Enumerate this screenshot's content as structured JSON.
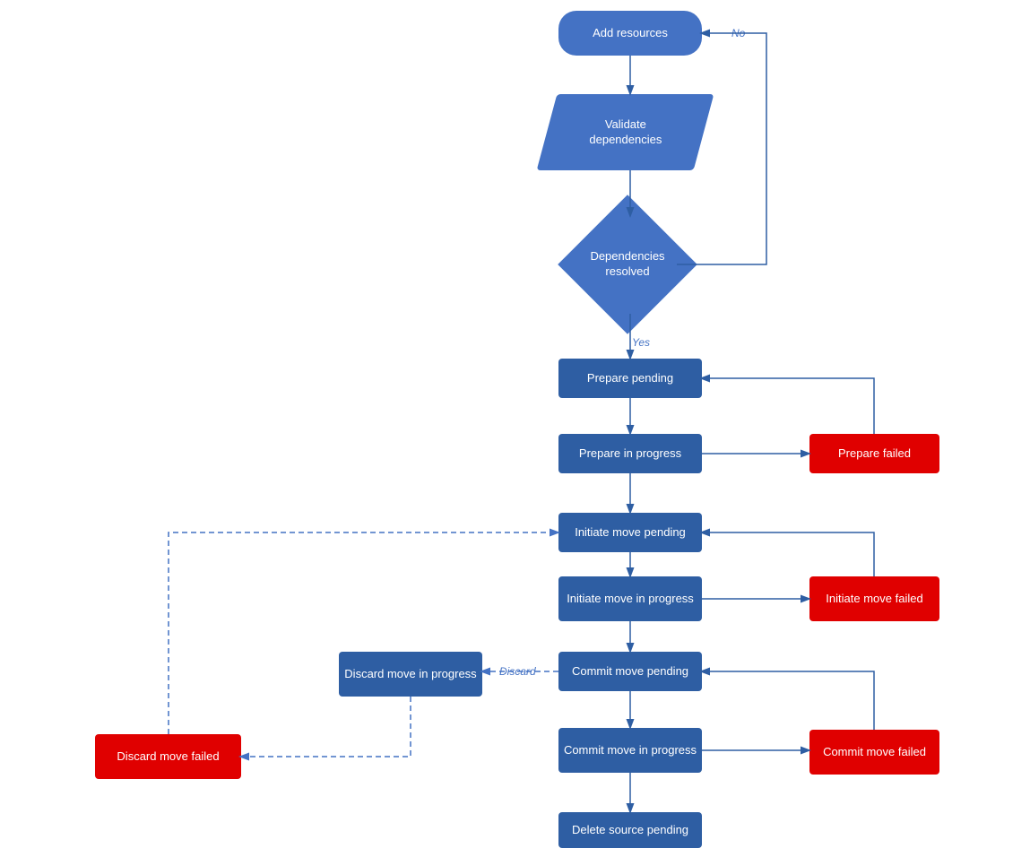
{
  "nodes": {
    "add_resources": {
      "label": "Add resources"
    },
    "validate_deps": {
      "label": "Validate\ndependencies"
    },
    "deps_resolved": {
      "label": "Dependencies\nresolved"
    },
    "prepare_pending": {
      "label": "Prepare pending"
    },
    "prepare_in_progress": {
      "label": "Prepare in progress"
    },
    "prepare_failed": {
      "label": "Prepare failed"
    },
    "initiate_move_pending": {
      "label": "Initiate move pending"
    },
    "initiate_move_in_progress": {
      "label": "Initiate move in\nprogress"
    },
    "initiate_move_failed": {
      "label": "Initiate move failed"
    },
    "commit_move_pending": {
      "label": "Commit move pending"
    },
    "discard_move_in_progress": {
      "label": "Discard move in\nprogress"
    },
    "commit_move_in_progress": {
      "label": "Commit move in\nprogress"
    },
    "discard_move_failed": {
      "label": "Discard move failed"
    },
    "commit_move_failed": {
      "label": "Commit move failed"
    },
    "delete_source_pending": {
      "label": "Delete source pending"
    }
  },
  "edge_labels": {
    "no": "No",
    "yes": "Yes",
    "discard": "Discard"
  },
  "colors": {
    "blue": "#4472c4",
    "dark_blue": "#2e5ea3",
    "red": "#e00000",
    "arrow": "#2e5ea3",
    "dashed": "#4472c4"
  }
}
